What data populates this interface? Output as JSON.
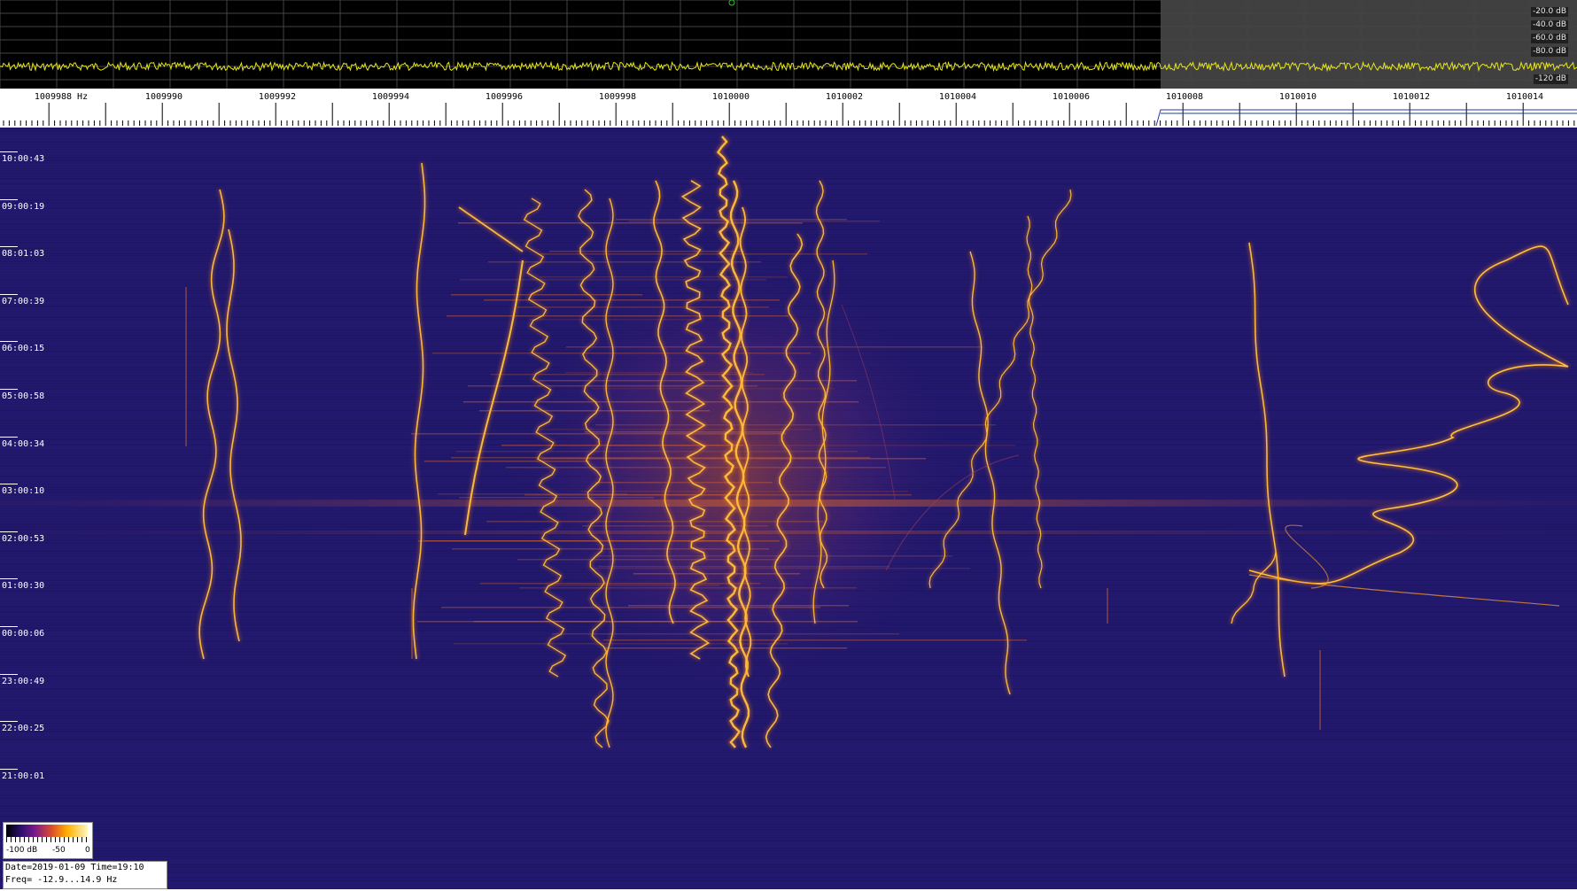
{
  "spectrum": {
    "db_labels": [
      "-20.0 dB",
      "-40.0 dB",
      "-60.0 dB",
      "-80.0 dB",
      "-120 dB"
    ]
  },
  "freq_axis": {
    "labels": [
      "1009988 Hz",
      "1009990",
      "1009992",
      "1009994",
      "1009996",
      "1009998",
      "1010000",
      "1010002",
      "1010004",
      "1010006",
      "1010008",
      "1010010",
      "1010012",
      "1010014"
    ],
    "values": [
      1009988,
      1009990,
      1009992,
      1009994,
      1009996,
      1009998,
      1010000,
      1010002,
      1010004,
      1010006,
      1010008,
      1010010,
      1010012,
      1010014
    ]
  },
  "time_axis": {
    "labels": [
      "10:00:43",
      "09:00:19",
      "08:01:03",
      "07:00:39",
      "06:00:15",
      "05:00:58",
      "04:00:34",
      "03:00:10",
      "02:00:53",
      "01:00:30",
      "00:00:06",
      "23:00:49",
      "22:00:25",
      "21:00:01"
    ]
  },
  "colorbar": {
    "min_label": "-100 dB",
    "mid_label": "-50",
    "max_label": "0"
  },
  "info": {
    "line1": "Date=2019-01-09 Time=19:10",
    "line2": "Freq= -12.9...14.9 Hz"
  },
  "colors": {
    "background": "#23196e",
    "spectrum_trace": "#e6e61e",
    "signal": "#ffb000"
  }
}
